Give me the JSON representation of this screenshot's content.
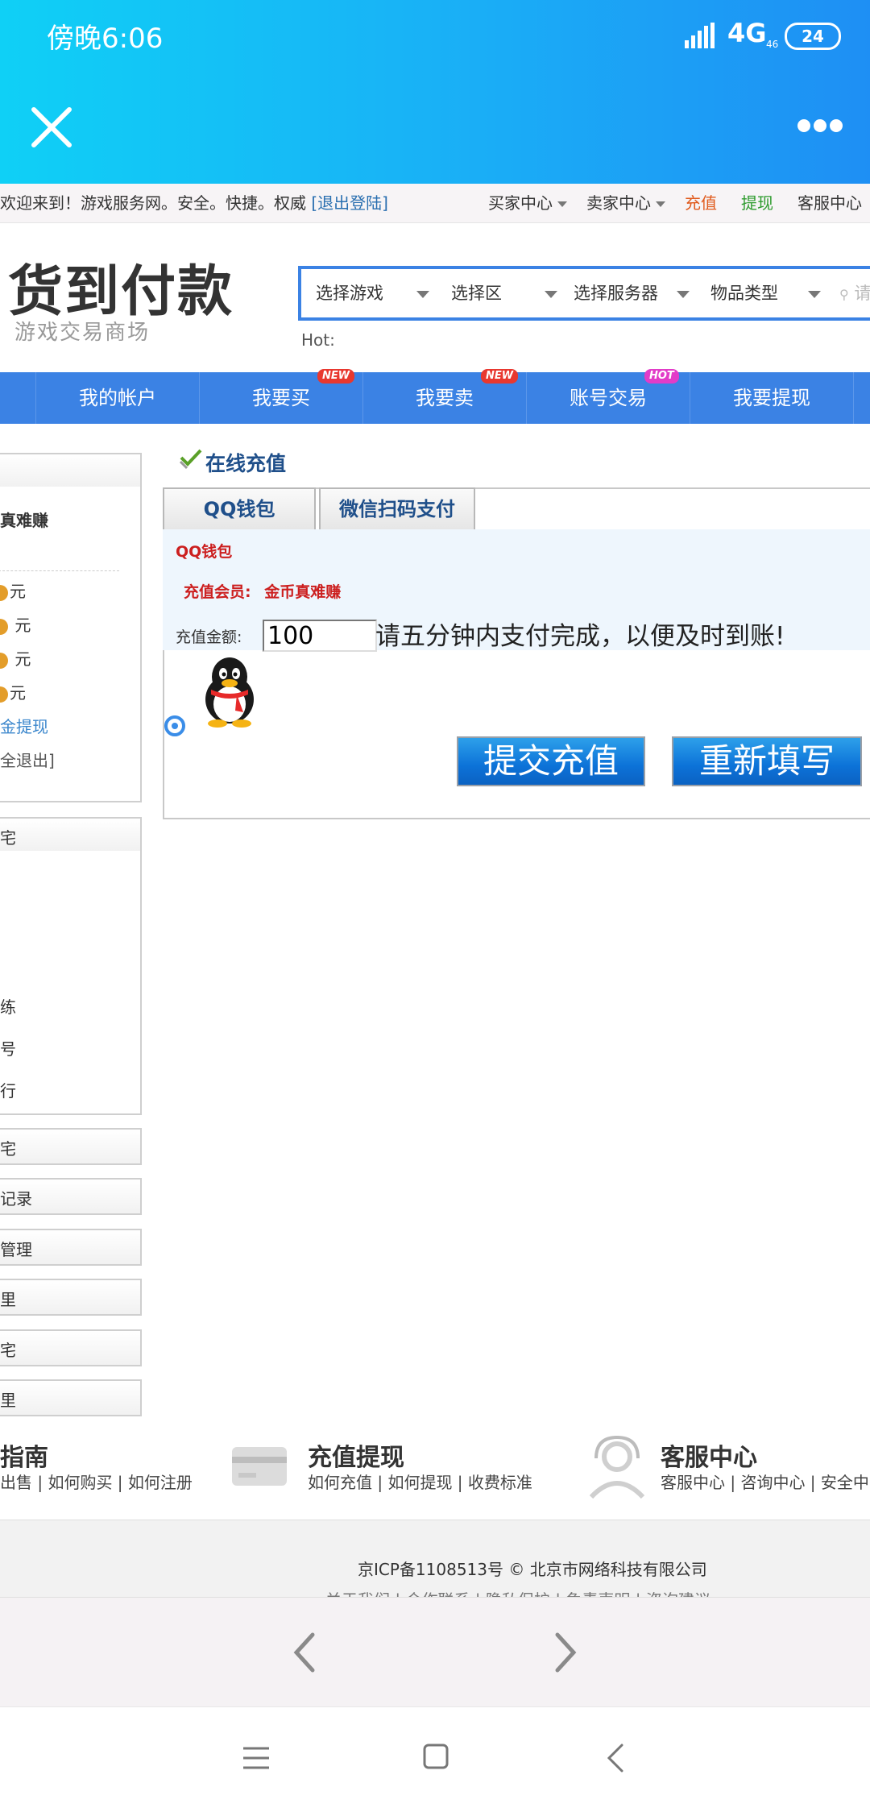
{
  "status_bar": {
    "time": "傍晚6:06",
    "network": "4G",
    "network_sub": "46",
    "battery": "24"
  },
  "browser": {
    "close_icon": "close-icon",
    "more_icon": "more-dots-icon"
  },
  "topbar": {
    "welcome": "欢迎来到！游戏服务网。安全。快捷。权威",
    "logout": "[退出登陆]",
    "buyer_center": "买家中心",
    "seller_center": "卖家中心",
    "recharge": "充值",
    "withdraw": "提现",
    "service_center": "客服中心",
    "colors": {
      "recharge": "#e05a1c",
      "withdraw": "#2e9b2e"
    }
  },
  "header": {
    "logo_main": "货到付款",
    "logo_sub": "游戏交易商场",
    "search": {
      "select_game": "选择游戏",
      "select_area": "选择区",
      "select_server": "选择服务器",
      "item_type": "物品类型",
      "input_placeholder": "请"
    },
    "hot_label": "Hot:"
  },
  "mainnav": {
    "items": [
      {
        "label": "我的帐户",
        "badge": ""
      },
      {
        "label": "我要买",
        "badge": "NEW"
      },
      {
        "label": "我要卖",
        "badge": "NEW"
      },
      {
        "label": "账号交易",
        "badge": "HOT"
      },
      {
        "label": "我要提现",
        "badge": ""
      }
    ]
  },
  "sidebar": {
    "user_name_partial": "真难赚",
    "balances": [
      "元",
      " 元",
      " 元",
      "元"
    ],
    "withdraw_link": "金提现",
    "logout_link": "全退出]",
    "menu_partial": [
      "宅",
      "练",
      "号",
      "行"
    ],
    "sections": [
      "宅",
      "记录",
      "管理",
      "里",
      "宅",
      "里"
    ]
  },
  "recharge": {
    "title": "在线充值",
    "tabs": [
      "QQ钱包",
      "微信扫码支付"
    ],
    "qq_wallet_label": "QQ钱包",
    "member_label": "充值会员:",
    "member_name": "金币真难赚",
    "amount_label": "充值金额:",
    "amount_value": "100",
    "amount_hint": "请五分钟内支付完成，以便及时到账!",
    "submit_button": "提交充值",
    "reset_button": "重新填写"
  },
  "footer": {
    "guide_title": "指南",
    "guide_links": "出售 | 如何购买 | 如何注册",
    "recharge_title": "充值提现",
    "recharge_links": "如何充值 | 如何提现 | 收费标准",
    "service_title": "客服中心",
    "service_links": "客服中心 | 咨询中心 | 安全中",
    "icp": "京ICP备1108513号 © 北京市网络科技有限公司",
    "links": "关于我们 | 合作联系 | 隐私保护 | 免责声明 | 咨询建议"
  }
}
